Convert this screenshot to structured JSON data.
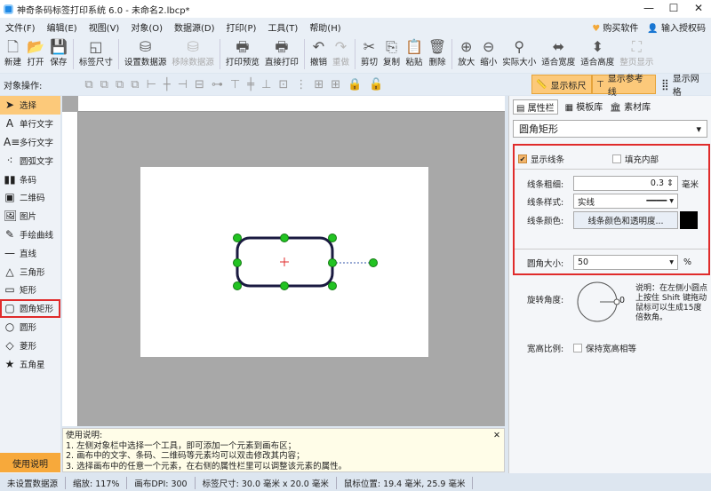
{
  "window": {
    "title": "神奇条码标签打印系统 6.0 - 未命名2.lbcp*",
    "minimize": "—",
    "maximize": "☐",
    "close": "✕"
  },
  "menu": {
    "items": [
      "文件(F)",
      "编辑(E)",
      "视图(V)",
      "对象(O)",
      "数据源(D)",
      "打印(P)",
      "工具(T)",
      "帮助(H)"
    ],
    "buy": "购买软件",
    "license": "输入授权码"
  },
  "toolbar": {
    "items": [
      {
        "label": "新建",
        "icon": "new-file-icon",
        "glyph": "🗋",
        "disabled": false
      },
      {
        "label": "打开",
        "icon": "open-icon",
        "glyph": "📂",
        "disabled": false
      },
      {
        "label": "保存",
        "icon": "save-icon",
        "glyph": "💾",
        "disabled": false
      },
      {
        "label": "标签尺寸",
        "icon": "label-size-icon",
        "glyph": "◱",
        "disabled": false
      },
      {
        "label": "设置数据源",
        "icon": "database-icon",
        "glyph": "⛁",
        "disabled": false
      },
      {
        "label": "移除数据源",
        "icon": "remove-database-icon",
        "glyph": "⛁",
        "disabled": true
      },
      {
        "label": "打印预览",
        "icon": "print-preview-icon",
        "glyph": "🖶",
        "disabled": false
      },
      {
        "label": "直接打印",
        "icon": "print-icon",
        "glyph": "🖶",
        "disabled": false
      },
      {
        "label": "撤销",
        "icon": "undo-icon",
        "glyph": "↶",
        "disabled": false
      },
      {
        "label": "重做",
        "icon": "redo-icon",
        "glyph": "↷",
        "disabled": true
      },
      {
        "label": "剪切",
        "icon": "cut-icon",
        "glyph": "✂",
        "disabled": false
      },
      {
        "label": "复制",
        "icon": "copy-icon",
        "glyph": "⎘",
        "disabled": false
      },
      {
        "label": "粘贴",
        "icon": "paste-icon",
        "glyph": "📋",
        "disabled": false
      },
      {
        "label": "删除",
        "icon": "delete-icon",
        "glyph": "🗑",
        "disabled": false
      },
      {
        "label": "放大",
        "icon": "zoom-in-icon",
        "glyph": "⊕",
        "disabled": false
      },
      {
        "label": "缩小",
        "icon": "zoom-out-icon",
        "glyph": "⊖",
        "disabled": false
      },
      {
        "label": "实际大小",
        "icon": "actual-size-icon",
        "glyph": "⚲",
        "disabled": false
      },
      {
        "label": "适合宽度",
        "icon": "fit-width-icon",
        "glyph": "⬌",
        "disabled": false
      },
      {
        "label": "适合高度",
        "icon": "fit-height-icon",
        "glyph": "⬍",
        "disabled": false
      },
      {
        "label": "整页显示",
        "icon": "full-page-icon",
        "glyph": "⛶",
        "disabled": true
      }
    ]
  },
  "ops": {
    "label": "对象操作:",
    "show_ruler": "显示标尺",
    "show_guides": "显示参考线",
    "show_grid": "显示网格"
  },
  "tools": [
    {
      "label": "选择",
      "icon": "pointer-icon",
      "glyph": "➤"
    },
    {
      "label": "单行文字",
      "icon": "text-icon",
      "glyph": "A"
    },
    {
      "label": "多行文字",
      "icon": "multiline-text-icon",
      "glyph": "A≡"
    },
    {
      "label": "圆弧文字",
      "icon": "arc-text-icon",
      "glyph": "⁖"
    },
    {
      "label": "条码",
      "icon": "barcode-icon",
      "glyph": "▮▮"
    },
    {
      "label": "二维码",
      "icon": "qrcode-icon",
      "glyph": "▣"
    },
    {
      "label": "图片",
      "icon": "image-icon",
      "glyph": "🖼"
    },
    {
      "label": "手绘曲线",
      "icon": "pen-icon",
      "glyph": "✎"
    },
    {
      "label": "直线",
      "icon": "line-icon",
      "glyph": "—"
    },
    {
      "label": "三角形",
      "icon": "triangle-icon",
      "glyph": "△"
    },
    {
      "label": "矩形",
      "icon": "rectangle-icon",
      "glyph": "▭"
    },
    {
      "label": "圆角矩形",
      "icon": "rounded-rect-icon",
      "glyph": "▢"
    },
    {
      "label": "圆形",
      "icon": "circle-icon",
      "glyph": "○"
    },
    {
      "label": "菱形",
      "icon": "diamond-icon",
      "glyph": "◇"
    },
    {
      "label": "五角星",
      "icon": "star-icon",
      "glyph": "★"
    }
  ],
  "help_button": "使用说明",
  "help": {
    "title": "使用说明:",
    "lines": [
      "1. 左侧对象栏中选择一个工具，即可添加一个元素到画布区；",
      "2. 画布中的文字、条码、二维码等元素均可以双击修改其内容；",
      "3. 选择画布中的任意一个元素，在右侧的属性栏里可以调整该元素的属性。"
    ],
    "close": "✕"
  },
  "status": {
    "datasource": "未设置数据源",
    "zoom": "缩放: 117%",
    "dpi": "画布DPI: 300",
    "size": "标签尺寸: 30.0 毫米 x 20.0 毫米",
    "mouse": "鼠标位置: 19.4 毫米, 25.9 毫米"
  },
  "panel": {
    "tabs": [
      "属性栏",
      "模板库",
      "素材库"
    ],
    "object_type": "圆角矩形",
    "show_line": "显示线条",
    "show_line_checked": true,
    "fill": "填充内部",
    "fill_checked": false,
    "line_width_label": "线条粗细:",
    "line_width": "0.3",
    "line_width_unit": "毫米",
    "line_style_label": "线条样式:",
    "line_style": "实线",
    "line_color_label": "线条颜色:",
    "line_color_button": "线条颜色和透明度...",
    "line_color": "#000000",
    "corner_label": "圆角大小:",
    "corner": "50",
    "corner_unit": "%",
    "rotation_label": "旋转角度:",
    "rotation": "0",
    "rotation_note": "说明：在左侧小圆点上按住 Shift 键拖动鼠标可以生成15度倍数角。",
    "aspect_label": "宽高比例:",
    "aspect_option": "保持宽高相等",
    "aspect_checked": false
  },
  "colors": {
    "accent": "#fcc97a",
    "highlight": "#e02b2b",
    "handle": "#22c322"
  }
}
